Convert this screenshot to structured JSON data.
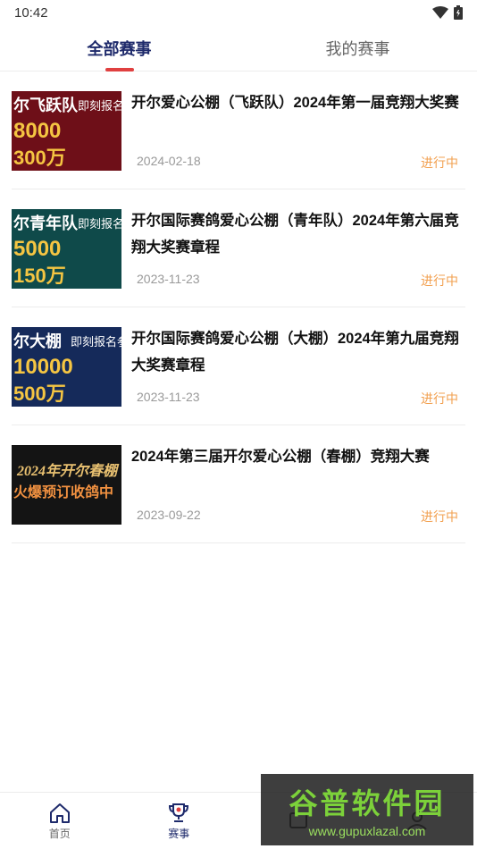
{
  "status_bar": {
    "time": "10:42"
  },
  "tabs": [
    {
      "label": "全部赛事",
      "active": true
    },
    {
      "label": "我的赛事",
      "active": false
    }
  ],
  "races": [
    {
      "title": "开尔爱心公棚（飞跃队）2024年第一届竞翔大奖赛",
      "date": "2024-02-18",
      "status": "进行中",
      "thumb": {
        "line1": "尔飞跃队",
        "tag": "即刻报名",
        "big": "8000",
        "big2": "300万",
        "bg": "#6e0f18"
      }
    },
    {
      "title": "开尔国际赛鸽爱心公棚（青年队）2024年第六届竞翔大奖赛章程",
      "date": "2023-11-23",
      "status": "进行中",
      "thumb": {
        "line1": "尔青年队",
        "tag": "即刻报名",
        "big": "5000",
        "big2": "150万",
        "bg": "#0f4a4a"
      }
    },
    {
      "title": "开尔国际赛鸽爱心公棚（大棚）2024年第九届竞翔大奖赛章程",
      "date": "2023-11-23",
      "status": "进行中",
      "thumb": {
        "line1": "尔大棚",
        "tag": "即刻报名参",
        "big": "10000",
        "big2": "500万",
        "bg": "#152a5a"
      }
    },
    {
      "title": "2024年第三届开尔爱心公棚（春棚）竞翔大赛",
      "date": "2023-09-22",
      "status": "进行中",
      "thumb": {
        "line1": "2024年开尔春棚",
        "tag": "火爆预订收鸽中",
        "big": "",
        "big2": "",
        "bg": "#141414"
      }
    }
  ],
  "bottom_nav": [
    {
      "label": "首页",
      "icon": "home-icon",
      "active": false
    },
    {
      "label": "赛事",
      "icon": "trophy-icon",
      "active": true
    },
    {
      "label": "",
      "icon": "tab3-icon",
      "active": false
    },
    {
      "label": "",
      "icon": "profile-icon",
      "active": false
    }
  ],
  "watermark": {
    "main": "谷普软件园",
    "url": "www.gupuxlazal.com"
  },
  "colors": {
    "accent": "#1e2a6b",
    "indicator": "#e04040",
    "status": "#f2a050"
  }
}
